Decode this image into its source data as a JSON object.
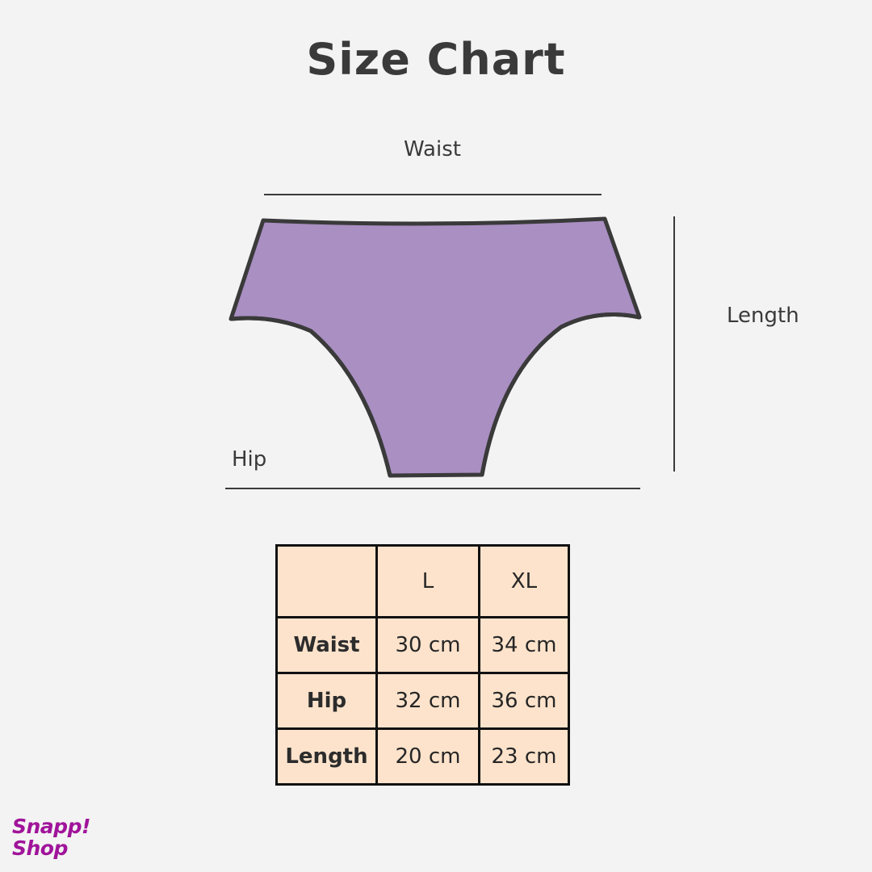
{
  "title": "Size Chart",
  "labels": {
    "waist": "Waist",
    "length": "Length",
    "hip": "Hip"
  },
  "colors": {
    "garment_fill": "#a98fc2",
    "garment_outline": "#3a3a3a",
    "table_fill": "#fde3cb",
    "logo": "#a0149a"
  },
  "table": {
    "headers": [
      "",
      "L",
      "XL"
    ],
    "rows": [
      {
        "label": "Waist",
        "L": "30 cm",
        "XL": "34 cm"
      },
      {
        "label": "Hip",
        "L": "32 cm",
        "XL": "36 cm"
      },
      {
        "label": "Length",
        "L": "20 cm",
        "XL": "23 cm"
      }
    ]
  },
  "logo": {
    "line1": "Snapp!",
    "line2": "Shop"
  }
}
